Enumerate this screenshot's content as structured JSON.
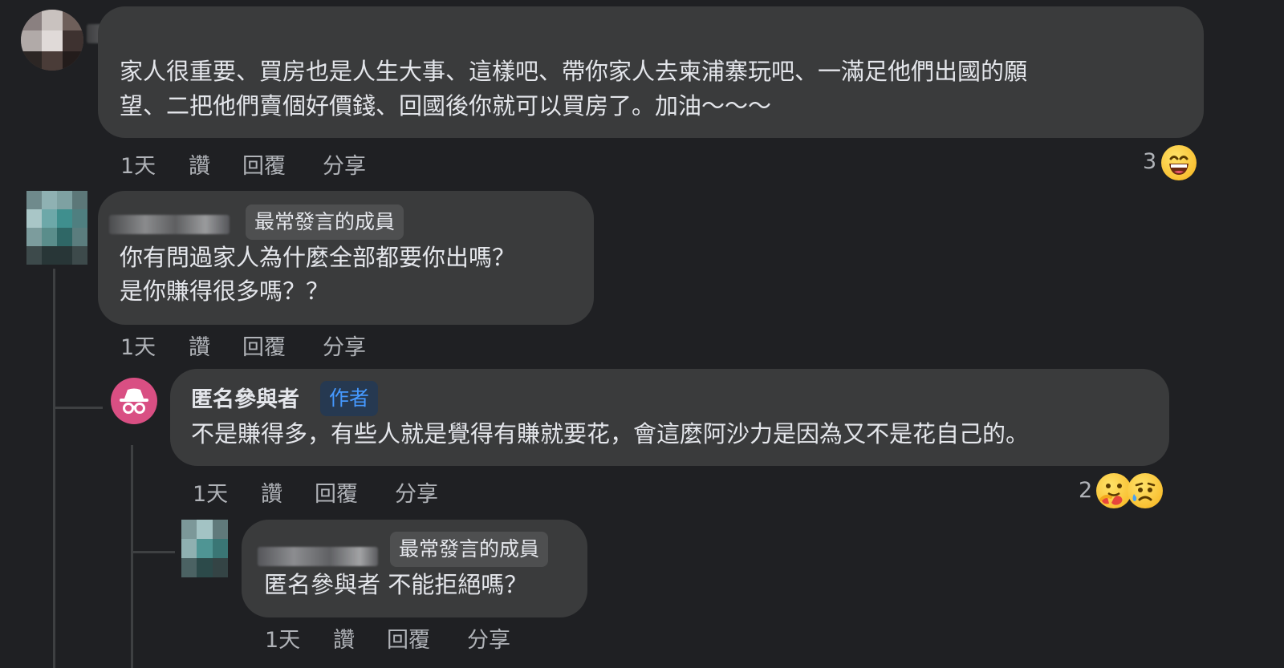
{
  "comments": [
    {
      "id": "c1",
      "text_lines": [
        "家人很重要、買房也是人生大事、這樣吧、帶你家人去柬浦寨玩吧、一滿足他們出國的願",
        "望、二把他們賣個好價錢、回國後你就可以買房了。加油～～～"
      ],
      "actions": {
        "time": "1天",
        "like": "讚",
        "reply": "回覆",
        "share": "分享"
      },
      "reactions": {
        "count": "3",
        "icons": [
          "grinning-face-icon"
        ]
      }
    },
    {
      "id": "c2",
      "badge": "最常發言的成員",
      "text_lines": [
        "你有問過家人為什麼全部都要你出嗎？",
        "是你賺得很多嗎？？"
      ],
      "actions": {
        "time": "1天",
        "like": "讚",
        "reply": "回覆",
        "share": "分享"
      }
    },
    {
      "id": "c3",
      "author": "匿名參與者",
      "badge": "作者",
      "text_lines": [
        "不是賺得多，有些人就是覺得有賺就要花，會這麼阿沙力是因為又不是花自己的。"
      ],
      "actions": {
        "time": "1天",
        "like": "讚",
        "reply": "回覆",
        "share": "分享"
      },
      "reactions": {
        "count": "2",
        "icons": [
          "care-hug-icon",
          "sad-face-icon"
        ]
      }
    },
    {
      "id": "c4",
      "badge": "最常發言的成員",
      "text_lines": [
        "匿名參與者 不能拒絕嗎？"
      ],
      "actions": {
        "time": "1天",
        "like": "讚",
        "reply": "回覆",
        "share": "分享"
      }
    }
  ],
  "colors": {
    "background": "#1f2023",
    "bubble": "#3a3b3c",
    "text": "#e4e6eb",
    "secondary_text": "#b0b3b8",
    "author_badge_text": "#4599ff",
    "anonymous_avatar": "#d94f83"
  }
}
